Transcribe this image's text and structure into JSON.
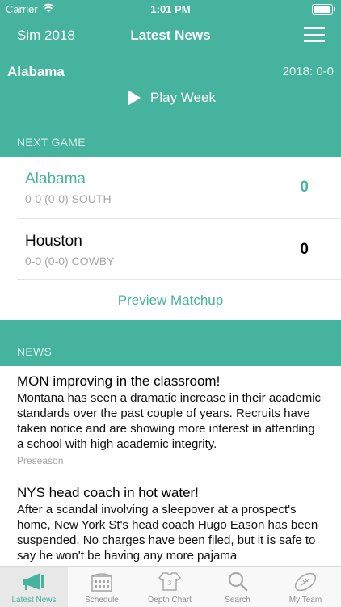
{
  "status_bar": {
    "carrier": "Carrier",
    "time": "1:01 PM"
  },
  "nav": {
    "left": "Sim 2018",
    "title": "Latest News"
  },
  "header": {
    "team": "Alabama",
    "record": "2018: 0-0",
    "play_label": "Play Week",
    "next_game_label": "NEXT GAME"
  },
  "matchup": {
    "home": {
      "name": "Alabama",
      "detail": "0-0 (0-0) SOUTH",
      "score": "0"
    },
    "away": {
      "name": "Houston",
      "detail": "0-0 (0-0) COWBY",
      "score": "0"
    },
    "preview_label": "Preview Matchup"
  },
  "news_label": "NEWS",
  "news": [
    {
      "headline": "MON improving in the classroom!",
      "body": "Montana has seen a dramatic increase in their academic standards over the past couple of years. Recruits have taken notice and are showing more interest in attending a school with high academic integrity.",
      "tag": "Preseason"
    },
    {
      "headline": "NYS head coach in hot water!",
      "body": "After a scandal involving a sleepover at a prospect's home, New York St's head coach Hugo Eason has been suspended. No charges have been filed, but it is safe to say he won't be having any more pajama",
      "tag": ""
    }
  ],
  "tabs": [
    {
      "label": "Latest News",
      "icon": "megaphone-icon"
    },
    {
      "label": "Schedule",
      "icon": "stadium-icon"
    },
    {
      "label": "Depth Chart",
      "icon": "jersey-icon"
    },
    {
      "label": "Search",
      "icon": "search-icon"
    },
    {
      "label": "My Team",
      "icon": "football-icon"
    }
  ],
  "colors": {
    "accent": "#45b39d",
    "secondary_text": "#a6a6a6"
  }
}
